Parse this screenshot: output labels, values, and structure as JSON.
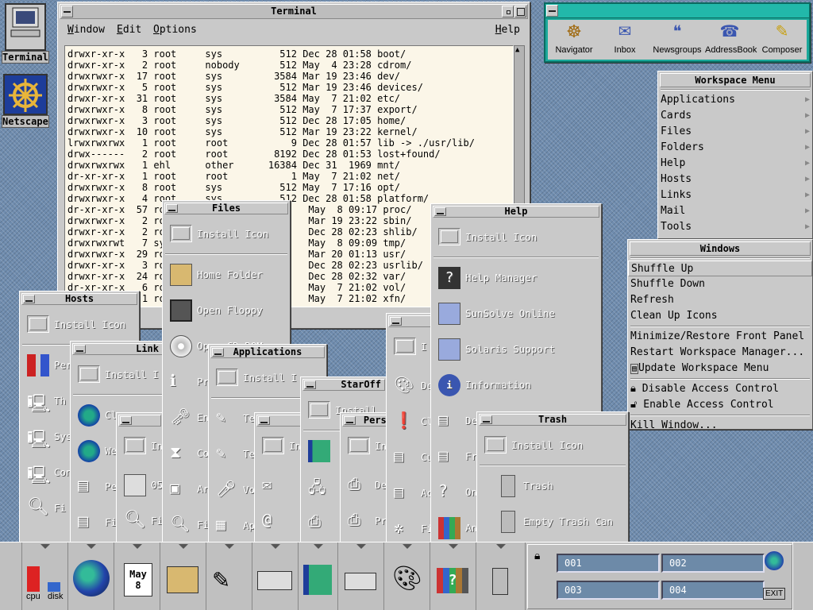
{
  "desktop": {
    "terminal_label": "Terminal",
    "netscape_label": "Netscape"
  },
  "terminal": {
    "title": "Terminal",
    "menu": {
      "window": "Window",
      "edit": "Edit",
      "options": "Options",
      "help": "Help"
    },
    "lines": [
      "drwxr-xr-x   3 root     sys          512 Dec 28 01:58 boot/",
      "drwxr-xr-x   2 root     nobody       512 May  4 23:28 cdrom/",
      "drwxrwxr-x  17 root     sys         3584 Mar 19 23:46 dev/",
      "drwxrwxr-x   5 root     sys          512 Mar 19 23:46 devices/",
      "drwxr-xr-x  31 root     sys         3584 May  7 21:02 etc/",
      "drwxrwxr-x   8 root     sys          512 May  7 17:37 export/",
      "drwxrwxr-x   3 root     sys          512 Dec 28 17:05 home/",
      "drwxrwxr-x  10 root     sys          512 Mar 19 23:22 kernel/",
      "lrwxrwxrwx   1 root     root           9 Dec 28 01:57 lib -> ./usr/lib/",
      "drwx------   2 root     root        8192 Dec 28 01:53 lost+found/",
      "drwxrwxrwx   1 ehl      other      16384 Dec 31  1969 mnt/",
      "dr-xr-xr-x   1 root     root           1 May  7 21:02 net/",
      "drwxrwxr-x   8 root     sys          512 May  7 17:16 opt/",
      "drwxrwxr-x   4 root     sys          512 Dec 28 01:58 platform/",
      "dr-xr-xr-x  57 root                       May  8 09:17 proc/",
      "drwxrwxr-x   2 ro                         Mar 19 23:22 sbin/",
      "drwxr-xr-x   2 ro                         Dec 28 02:23 shlib/",
      "drwxrwxrwt   7 sy                         May  8 09:09 tmp/",
      "drwxrwxr-x  29 ro                         Mar 20 01:13 usr/",
      "drwxr-xr-x   3 ro                         Dec 28 02:23 usrlib/",
      "drwxr-xr-x  24 ro                         Dec 28 02:32 var/",
      "dr-xr-xr-x   6 ro                         May  7 21:02 vol/",
      "drwxr-xr-x   1 ro                         May  7 21:02 xfn/"
    ]
  },
  "netscape_bar": {
    "items": [
      "Navigator",
      "Inbox",
      "Newsgroups",
      "AddressBook",
      "Composer"
    ]
  },
  "workspace_menu": {
    "title": "Workspace Menu",
    "items": [
      "Applications",
      "Cards",
      "Files",
      "Folders",
      "Help",
      "Hosts",
      "Links",
      "Mail",
      "Tools"
    ]
  },
  "windows_menu": {
    "title": "Windows",
    "items": [
      "Shuffle Up",
      "Shuffle Down",
      "Refresh",
      "Clean Up Icons",
      "Minimize/Restore Front Panel",
      "Restart Workspace Manager...",
      "Update Workspace Menu",
      "Disable Access Control",
      "Enable Access Control",
      "Kill Window..."
    ]
  },
  "common": {
    "install_icon": "Install Icon"
  },
  "files": {
    "title": "Files",
    "items": [
      "Home Folder",
      "Open Floppy",
      "Open CD-ROM"
    ]
  },
  "help": {
    "title": "Help",
    "items": [
      "Help Manager",
      "SunSolve Online",
      "Solaris Support",
      "Information"
    ]
  },
  "hosts": {
    "title": "Hosts",
    "items": [
      "Per",
      "Th",
      "Sys",
      "Con",
      "Fi"
    ]
  },
  "links": {
    "title": "Link",
    "items": [
      "Cl",
      "We",
      "Pe",
      "Fi"
    ]
  },
  "applications": {
    "title": "Applications",
    "items": [
      "Te",
      "Te",
      "Vo",
      "Ap"
    ]
  },
  "staroffice": {
    "title": "StarOff",
    "install": "Install"
  },
  "personal": {
    "title": "Perso",
    "items": [
      "De",
      "Pr"
    ]
  },
  "cards": {
    "items": [
      "05",
      "Fi"
    ]
  },
  "trash": {
    "title": "Trash",
    "items": [
      "Trash",
      "Empty Trash Can"
    ]
  },
  "front_panel": {
    "cpu": "cpu",
    "disk": "disk",
    "date_month": "May",
    "date_day": "8",
    "workspaces": [
      "001",
      "002",
      "003",
      "004"
    ],
    "exit": "EXIT"
  }
}
